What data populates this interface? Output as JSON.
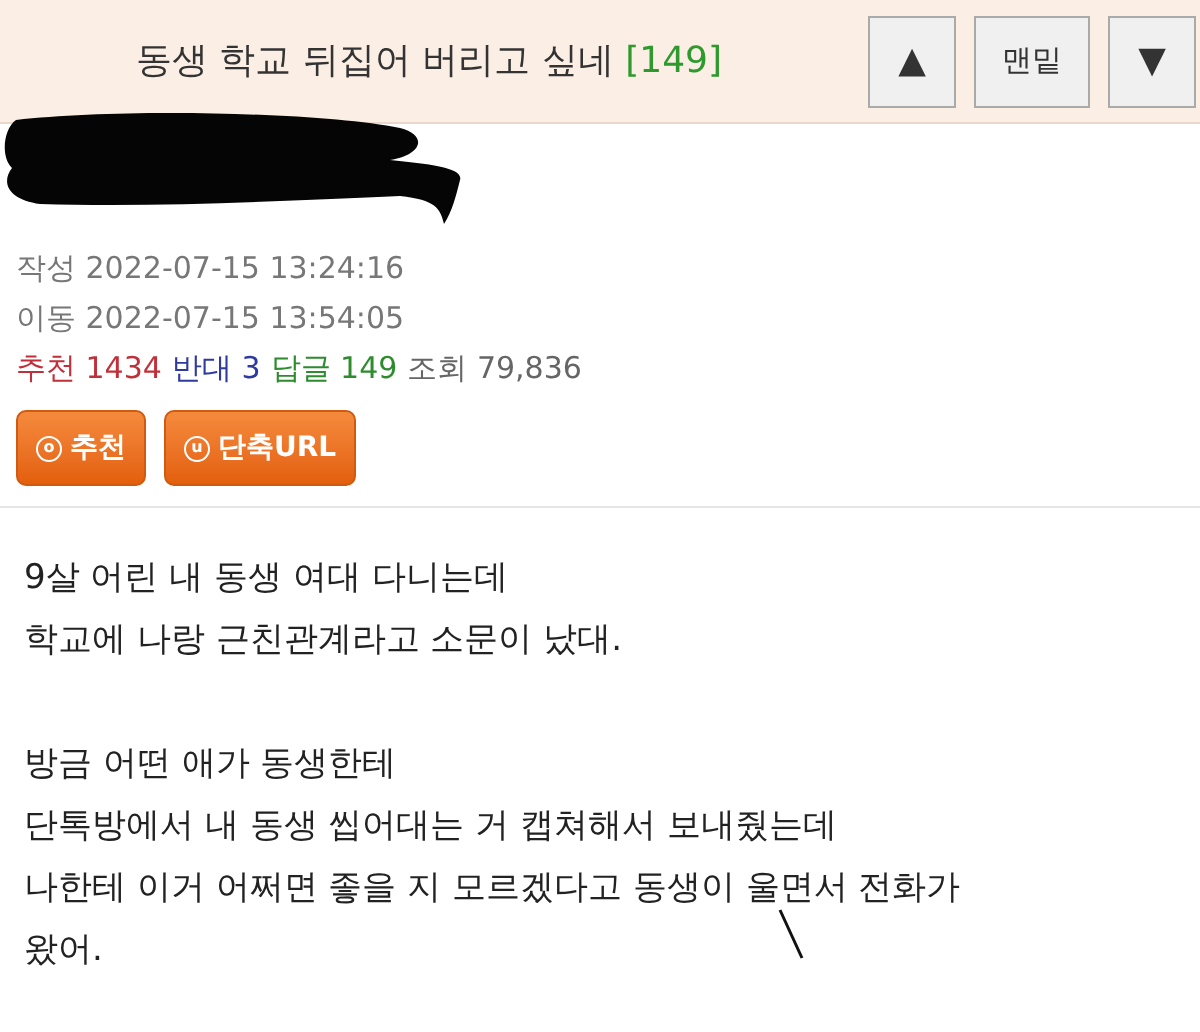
{
  "header": {
    "title": "동생 학교 뒤집어 버리고 싶네",
    "reply_count": "[149]",
    "buttons": [
      {
        "kind": "up",
        "label": "▲"
      },
      {
        "kind": "text",
        "label": "맨밑"
      },
      {
        "kind": "down",
        "label": "▼"
      }
    ]
  },
  "meta": {
    "written_label": "작성",
    "written": "2022-07-15 13:24:16",
    "moved_label": "이동",
    "moved": "2022-07-15 13:54:05",
    "stats": [
      {
        "label": "추천",
        "value": "1434",
        "color": "#c0303a"
      },
      {
        "label": "반대",
        "value": "3",
        "color": "#2f3aa0"
      },
      {
        "label": "답글",
        "value": "149",
        "color": "#2e8b2e"
      },
      {
        "label": "조회",
        "value": "79,836",
        "color": "#666666"
      }
    ]
  },
  "actions": [
    {
      "icon": "o",
      "label": "추천"
    },
    {
      "icon": "u",
      "label": "단축URL"
    }
  ],
  "body": [
    [
      "9살 어린 내 동생 여대 다니는데",
      "학교에 나랑 근친관계라고 소문이 났대."
    ],
    [
      "방금 어떤 애가 동생한테",
      "단톡방에서 내 동생 씹어대는 거 캡쳐해서 보내줬는데",
      "나한테 이거 어쩌면 좋을 지 모르겠다고 동생이 울면서 전화가",
      "왔어."
    ]
  ]
}
